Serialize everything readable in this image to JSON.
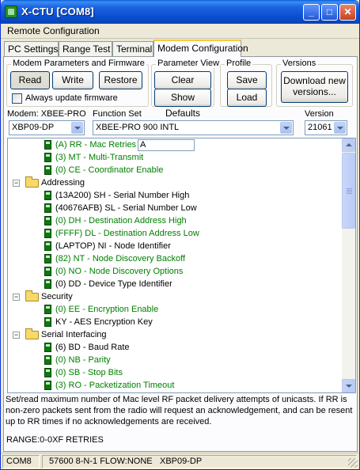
{
  "window": {
    "title": "X-CTU  [COM8]",
    "minimize": "_",
    "maximize": "□",
    "close": "✕"
  },
  "menu": {
    "remote_config": "Remote Configuration"
  },
  "tabs": [
    "PC Settings",
    "Range Test",
    "Terminal",
    "Modem Configuration"
  ],
  "active_tab": "Modem Configuration",
  "groups": {
    "modem_params": {
      "label": "Modem Parameters and Firmware",
      "read": "Read",
      "write": "Write",
      "restore": "Restore",
      "always_update": "Always update firmware"
    },
    "param_view": {
      "label": "Parameter View",
      "clear_screen": "Clear Screen",
      "show_defaults": "Show Defaults"
    },
    "profile": {
      "label": "Profile",
      "save": "Save",
      "load": "Load"
    },
    "versions": {
      "label": "Versions",
      "download_line1": "Download new",
      "download_line2": "versions..."
    }
  },
  "modem": {
    "modem_label": "Modem: XBEE-PRO",
    "modem_value": "XBP09-DP",
    "function_label": "Function Set",
    "function_value": "XBEE-PRO 900 INTL",
    "version_label": "Version",
    "version_value": "21061"
  },
  "tree": {
    "edit_value": "A",
    "rows": [
      {
        "kind": "param",
        "text": "(A) RR - Mac Retries",
        "green": true
      },
      {
        "kind": "param",
        "text": "(3) MT - Multi-Transmit",
        "green": true
      },
      {
        "kind": "param",
        "text": "(0) CE - Coordinator Enable",
        "green": true
      },
      {
        "kind": "folder",
        "text": "Addressing",
        "green": false
      },
      {
        "kind": "param",
        "text": "(13A200) SH - Serial Number High",
        "green": false
      },
      {
        "kind": "param",
        "text": "(40676AFB) SL - Serial Number Low",
        "green": false
      },
      {
        "kind": "param",
        "text": "(0) DH - Destination Address High",
        "green": true
      },
      {
        "kind": "param",
        "text": "(FFFF) DL - Destination Address Low",
        "green": true
      },
      {
        "kind": "param",
        "text": "(LAPTOP) NI - Node Identifier",
        "green": false
      },
      {
        "kind": "param",
        "text": "(82) NT - Node Discovery Backoff",
        "green": true
      },
      {
        "kind": "param",
        "text": "(0) NO - Node Discovery Options",
        "green": true
      },
      {
        "kind": "param",
        "text": "(0) DD - Device Type Identifier",
        "green": false
      },
      {
        "kind": "folder",
        "text": "Security",
        "green": false
      },
      {
        "kind": "param",
        "text": "(0) EE - Encryption Enable",
        "green": true
      },
      {
        "kind": "param",
        "text": "KY - AES Encryption Key",
        "green": false
      },
      {
        "kind": "folder",
        "text": "Serial Interfacing",
        "green": false
      },
      {
        "kind": "param",
        "text": "(6) BD - Baud Rate",
        "green": false
      },
      {
        "kind": "param",
        "text": "(0) NB - Parity",
        "green": true
      },
      {
        "kind": "param",
        "text": "(0) SB - Stop Bits",
        "green": true
      },
      {
        "kind": "param",
        "text": "(3) RO - Packetization Timeout",
        "green": true
      }
    ]
  },
  "description": "Set/read maximum number of Mac level RF packet delivery attempts of unicasts. If RR is non-zero packets sent from the radio will request an acknowledgement, and can be resent up to RR times if no acknowledgements are received.",
  "range": "RANGE:0-0XF  RETRIES",
  "status": {
    "port": "COM8",
    "settings": "57600 8-N-1  FLOW:NONE",
    "model": "XBP09-DP"
  },
  "colors": {
    "green_text": "#008000",
    "title_blue": "#0a4fd0",
    "window_bg": "#ece9d8"
  }
}
